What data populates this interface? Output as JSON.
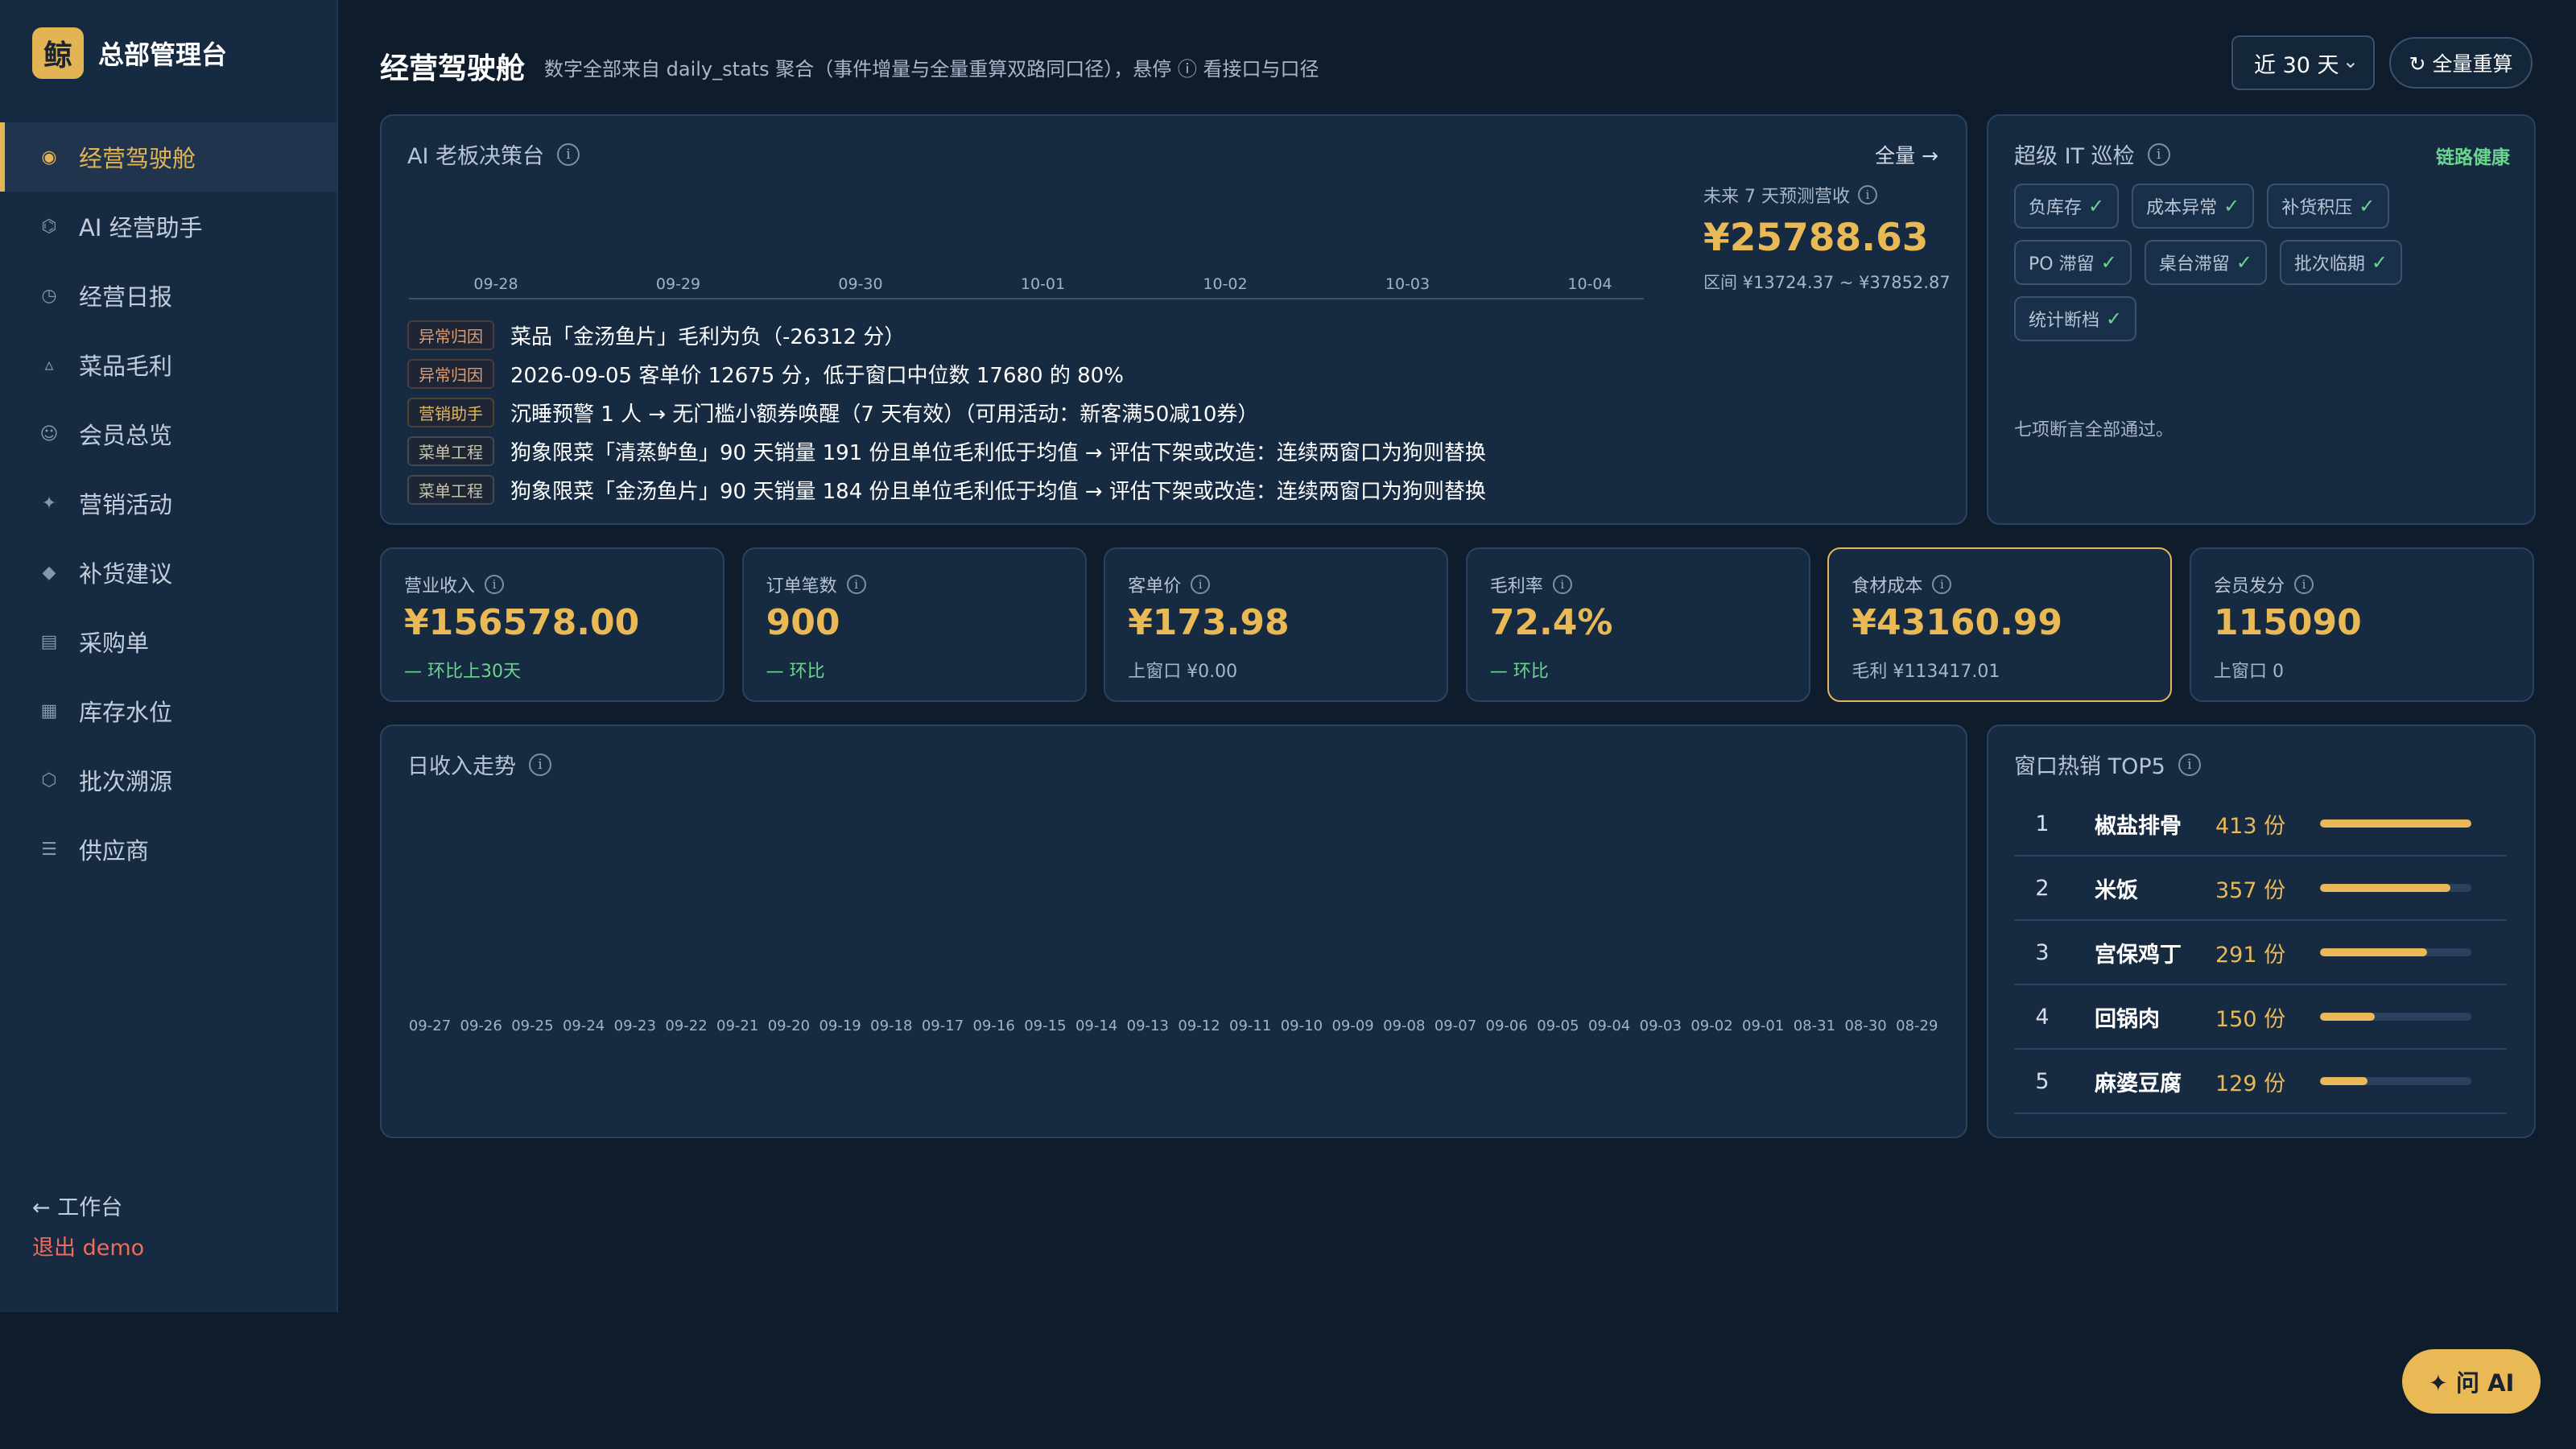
{
  "brand": {
    "logo_char": "鲸",
    "title": "总部管理台"
  },
  "sidebar": {
    "items": [
      {
        "label": "经营驾驶舱",
        "icon": "dashboard-icon",
        "glyph": "◉",
        "active": true
      },
      {
        "label": "AI 经营助手",
        "icon": "ai-assistant-icon",
        "glyph": "⌬"
      },
      {
        "label": "经营日报",
        "icon": "report-icon",
        "glyph": "◷"
      },
      {
        "label": "菜品毛利",
        "icon": "dish-icon",
        "glyph": "▵"
      },
      {
        "label": "会员总览",
        "icon": "member-icon",
        "glyph": "☺"
      },
      {
        "label": "营销活动",
        "icon": "marketing-icon",
        "glyph": "✦"
      },
      {
        "label": "补货建议",
        "icon": "restock-icon",
        "glyph": "◆"
      },
      {
        "label": "采购单",
        "icon": "purchase-icon",
        "glyph": "▤"
      },
      {
        "label": "库存水位",
        "icon": "inventory-icon",
        "glyph": "▦"
      },
      {
        "label": "批次溯源",
        "icon": "batch-icon",
        "glyph": "⬡"
      },
      {
        "label": "供应商",
        "icon": "supplier-icon",
        "glyph": "☰"
      }
    ],
    "back_label": "← 工作台",
    "logout_label": "退出 demo"
  },
  "header": {
    "title": "经营驾驶舱",
    "description": "数字全部来自 daily_stats 聚合（事件增量与全量重算双路同口径），悬停 ⓘ 看接口与口径",
    "range_value": "近 30 天",
    "recalc_label": "↻ 全量重算"
  },
  "ai_card": {
    "title": "AI 老板决策台",
    "link_label": "全量 →",
    "forecast_dates": [
      "09-28",
      "09-29",
      "09-30",
      "10-01",
      "10-02",
      "10-03",
      "10-04"
    ],
    "forecast_label": "未来 7 天预测营收",
    "forecast_value": "¥25788.63",
    "forecast_range": "区间 ¥13724.37 ~ ¥37852.87",
    "alerts": [
      {
        "tag": "异常归因",
        "text": "菜品「金汤鱼片」毛利为负（-26312 分）"
      },
      {
        "tag": "异常归因",
        "text": "2026-09-05 客单价 12675 分，低于窗口中位数 17680 的 80%"
      },
      {
        "tag": "营销助手",
        "text": "沉睡预警 1 人 → 无门槛小额券唤醒（7 天有效）（可用活动：新客满50减10券）"
      },
      {
        "tag": "菜单工程",
        "text": "狗象限菜「清蒸鲈鱼」90 天销量 191 份且单位毛利低于均值 → 评估下架或改造：连续两窗口为狗则替换"
      },
      {
        "tag": "菜单工程",
        "text": "狗象限菜「金汤鱼片」90 天销量 184 份且单位毛利低于均值 → 评估下架或改造：连续两窗口为狗则替换"
      }
    ]
  },
  "it_check": {
    "title": "超级 IT 巡检",
    "status": "链路健康",
    "items": [
      {
        "label": "负库存",
        "mark": "✓"
      },
      {
        "label": "成本异常",
        "mark": "✓"
      },
      {
        "label": "补货积压",
        "mark": "✓"
      },
      {
        "label": "PO 滞留",
        "mark": "✓"
      },
      {
        "label": "桌台滞留",
        "mark": "✓"
      },
      {
        "label": "批次临期",
        "mark": "✓"
      },
      {
        "label": "统计断档",
        "mark": "✓"
      }
    ],
    "note": "七项断言全部通过。"
  },
  "kpis": [
    {
      "label": "营业收入",
      "value": "¥156578.00",
      "sub": "— 环比上30天",
      "sub_color": "green"
    },
    {
      "label": "订单笔数",
      "value": "900",
      "sub": "— 环比",
      "sub_color": "green"
    },
    {
      "label": "客单价",
      "value": "¥173.98",
      "sub": "上窗口 ¥0.00"
    },
    {
      "label": "毛利率",
      "value": "72.4%",
      "sub": "— 环比",
      "sub_color": "green"
    },
    {
      "label": "食材成本",
      "value": "¥43160.99",
      "sub": "毛利 ¥113417.01",
      "highlight": true
    },
    {
      "label": "会员发分",
      "value": "115090",
      "sub": "上窗口 0"
    }
  ],
  "trend": {
    "title": "日收入走势",
    "dates": [
      "09-27",
      "09-26",
      "09-25",
      "09-24",
      "09-23",
      "09-22",
      "09-21",
      "09-20",
      "09-19",
      "09-18",
      "09-17",
      "09-16",
      "09-15",
      "09-14",
      "09-13",
      "09-12",
      "09-11",
      "09-10",
      "09-09",
      "09-08",
      "09-07",
      "09-06",
      "09-05",
      "09-04",
      "09-03",
      "09-02",
      "09-01",
      "08-31",
      "08-30",
      "08-29"
    ]
  },
  "top5": {
    "title": "窗口热销 TOP5",
    "unit": "份",
    "items": [
      {
        "rank": "1",
        "name": "椒盐排骨",
        "count": "413 份",
        "ratio": 1.0
      },
      {
        "rank": "2",
        "name": "米饭",
        "count": "357 份",
        "ratio": 0.864
      },
      {
        "rank": "3",
        "name": "宫保鸡丁",
        "count": "291 份",
        "ratio": 0.705
      },
      {
        "rank": "4",
        "name": "回锅肉",
        "count": "150 份",
        "ratio": 0.363
      },
      {
        "rank": "5",
        "name": "麻婆豆腐",
        "count": "129 份",
        "ratio": 0.312
      }
    ]
  },
  "ask_ai": {
    "label": "✦ 问 AI"
  },
  "colors": {
    "accent": "#e8b955",
    "success": "#6bd48f",
    "danger": "#ef6b5b",
    "background": "#0f1c2c",
    "card": "#162a41"
  }
}
